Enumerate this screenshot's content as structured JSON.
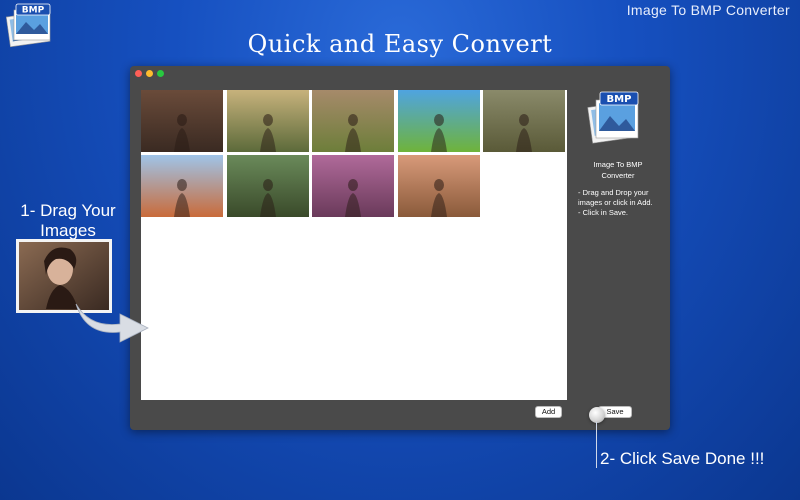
{
  "app": {
    "name": "Image To BMP Converter",
    "logo_text": "BMP"
  },
  "headline": "Quick and Easy Convert",
  "window": {
    "side_title": "Image  To BMP\nConverter",
    "side_steps": "- Drag and Drop your images or click in Add.\n- Click in Save.",
    "add_label": "Add",
    "save_label": "Save"
  },
  "thumbnails": [
    {
      "name": "woman-portrait",
      "top": "#6a4b3a",
      "bottom": "#3a2a22"
    },
    {
      "name": "man-sitting-sunset",
      "top": "#c7b27c",
      "bottom": "#5c6a3a"
    },
    {
      "name": "girl-under-tree",
      "top": "#a68a6a",
      "bottom": "#6d7e3a"
    },
    {
      "name": "girl-with-balloons",
      "top": "#4fa4e0",
      "bottom": "#6fb33a"
    },
    {
      "name": "girl-in-field",
      "top": "#8a8a6a",
      "bottom": "#5a5a38"
    },
    {
      "name": "woman-red-hat",
      "top": "#9fc4e8",
      "bottom": "#c96b3a"
    },
    {
      "name": "child-with-teddy",
      "top": "#6a8a5a",
      "bottom": "#3a4a2a"
    },
    {
      "name": "dogs-in-flowers",
      "top": "#b06a9a",
      "bottom": "#6a3a5a"
    },
    {
      "name": "girl-on-road",
      "top": "#d89a7a",
      "bottom": "#8a5a3a"
    }
  ],
  "instructions": {
    "step1": "1- Drag Your\nImages",
    "step2": "2- Click Save Done !!!"
  },
  "colors": {
    "background": "#1650c0",
    "window": "#4a4a4a",
    "drop_area": "#ffffff"
  },
  "icons": {
    "corner_logo": "bmp-logo-icon",
    "side_logo": "bmp-logo-icon",
    "arrow": "curved-arrow-icon",
    "click": "click-indicator-icon"
  }
}
